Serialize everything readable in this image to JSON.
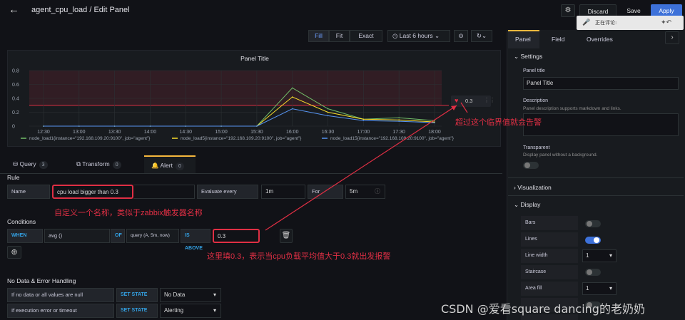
{
  "header": {
    "title": "agent_cpu_load / Edit Panel",
    "discard": "Discard",
    "save": "Save",
    "apply": "Apply",
    "popup_text": "正在评论:"
  },
  "toolbar": {
    "fill": "Fill",
    "fit": "Fit",
    "exact": "Exact",
    "time_range": "Last 6 hours"
  },
  "panel": {
    "title": "Panel Title",
    "threshold_value": "0.3"
  },
  "chart_data": {
    "type": "line",
    "title": "Panel Title",
    "x": [
      "12:30",
      "13:00",
      "13:30",
      "14:00",
      "14:30",
      "15:00",
      "15:30",
      "16:00",
      "16:30",
      "17:00",
      "17:30",
      "18:00"
    ],
    "y_ticks": [
      "0",
      "0.2",
      "0.4",
      "0.6",
      "0.8"
    ],
    "ylim": [
      0,
      0.8
    ],
    "threshold": 0.3,
    "series": [
      {
        "name": "node_load1{instance=\"192.168.109.20:9100\", job=\"agent\"}",
        "color": "#73bf69",
        "values": [
          0,
          0,
          0,
          0,
          0,
          0,
          0,
          0.55,
          0.25,
          0.1,
          0.12,
          0.08
        ]
      },
      {
        "name": "node_load5{instance=\"192.168.109.20:9100\", job=\"agent\"}",
        "color": "#fade2a",
        "values": [
          0,
          0,
          0,
          0,
          0,
          0,
          0,
          0.42,
          0.2,
          0.1,
          0.09,
          0.06
        ]
      },
      {
        "name": "node_load15{instance=\"192.168.109.20:9100\", job=\"agent\"}",
        "color": "#5794f2",
        "values": [
          0,
          0,
          0,
          0,
          0,
          0,
          0,
          0.25,
          0.15,
          0.08,
          0.07,
          0.05
        ]
      }
    ]
  },
  "tabs": {
    "query": "Query",
    "query_count": "3",
    "transform": "Transform",
    "transform_count": "0",
    "alert": "Alert",
    "alert_count": "0"
  },
  "rule": {
    "section": "Rule",
    "name_label": "Name",
    "name_value": "cpu load bigger than 0.3",
    "eval_label": "Evaluate every",
    "eval_value": "1m",
    "for_label": "For",
    "for_value": "5m"
  },
  "conditions": {
    "section": "Conditions",
    "when": "WHEN",
    "func": "avg ()",
    "of": "OF",
    "query": "query (A, 5m, now)",
    "is_above": "IS ABOVE",
    "value": "0.3"
  },
  "nodata": {
    "section": "No Data & Error Handling",
    "row1_label": "If no data or all values are null",
    "row1_kw": "SET STATE TO",
    "row1_value": "No Data",
    "row2_label": "If execution error or timeout",
    "row2_kw": "SET STATE TO",
    "row2_value": "Alerting"
  },
  "annotations": {
    "threshold": "超过这个临界值就会告警",
    "name": "自定义一个名称，类似于zabbix触发器名称",
    "value": "这里填0.3，表示当cpu负载平均值大于0.3就出发报警"
  },
  "rightpane": {
    "tab_panel": "Panel",
    "tab_field": "Field",
    "tab_overrides": "Overrides",
    "settings": "Settings",
    "panel_title_label": "Panel title",
    "panel_title_value": "Panel Title",
    "description_label": "Description",
    "description_hint": "Panel description supports markdown and links.",
    "transparent_label": "Transparent",
    "transparent_hint": "Display panel without a background.",
    "visualization": "Visualization",
    "display": "Display",
    "bars": "Bars",
    "lines": "Lines",
    "line_width": "Line width",
    "line_width_value": "1",
    "staircase": "Staircase",
    "area_fill": "Area fill",
    "area_fill_value": "1"
  },
  "watermark": "CSDN @爱看square dancing的老奶奶"
}
